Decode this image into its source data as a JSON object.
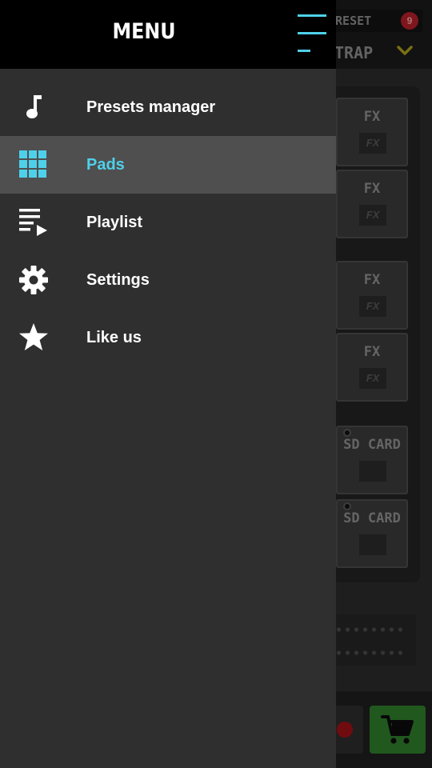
{
  "drawer": {
    "title": "MENU",
    "accent_color": "#4fd0ea",
    "items": [
      {
        "label": "Presets manager",
        "icon": "music-note-icon",
        "active": false
      },
      {
        "label": "Pads",
        "icon": "pads-grid-icon",
        "active": true
      },
      {
        "label": "Playlist",
        "icon": "playlist-icon",
        "active": false
      },
      {
        "label": "Settings",
        "icon": "gear-icon",
        "active": false
      },
      {
        "label": "Like us",
        "icon": "star-icon",
        "active": false
      }
    ]
  },
  "background": {
    "preset_label": "PRESET",
    "preset_badge": "9",
    "genre": "TRAP",
    "pads": [
      {
        "label": "FX",
        "chip": "FX"
      },
      {
        "label": "FX",
        "chip": "FX"
      },
      {
        "label": "FX",
        "chip": "FX"
      },
      {
        "label": "FX",
        "chip": "FX"
      },
      {
        "label": "SD CARD",
        "chip": ""
      },
      {
        "label": "SD CARD",
        "chip": ""
      }
    ]
  }
}
